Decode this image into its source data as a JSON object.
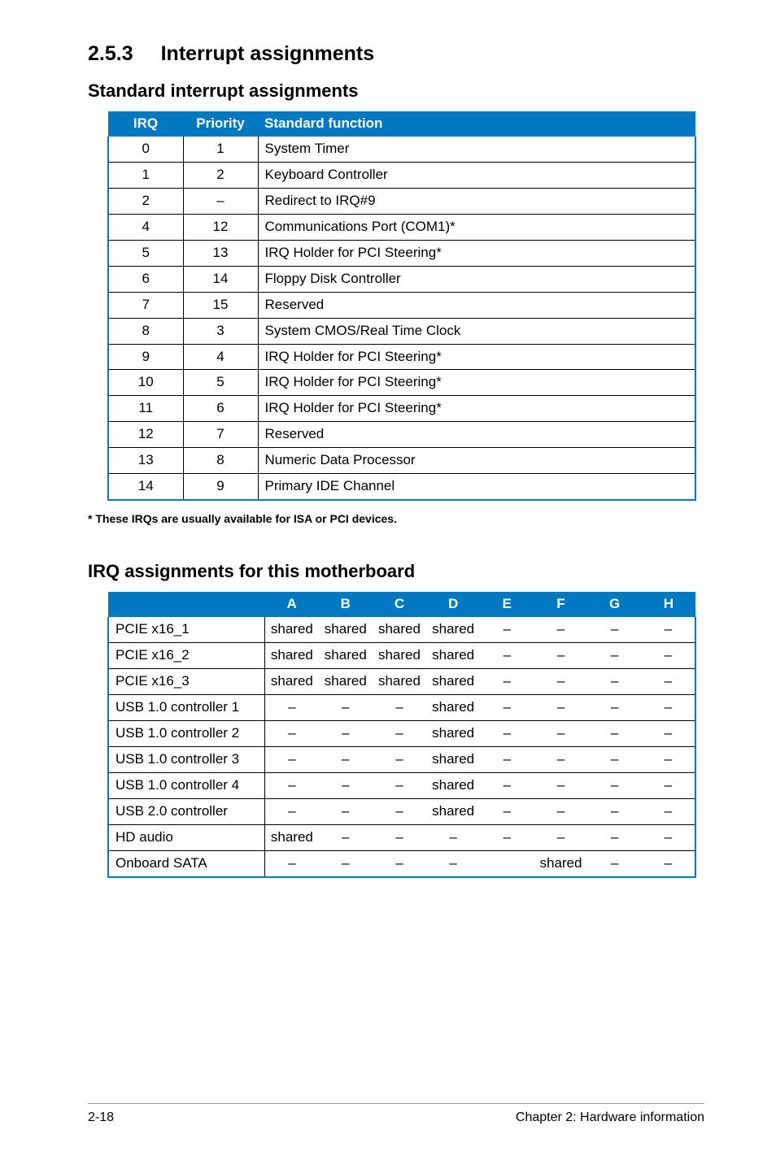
{
  "heading": {
    "number": "2.5.3",
    "title": "Interrupt assignments"
  },
  "sub1": "Standard interrupt assignments",
  "t1": {
    "headers": {
      "irq": "IRQ",
      "priority": "Priority",
      "func": "Standard function"
    },
    "rows": [
      {
        "irq": "0",
        "priority": "1",
        "func": "System Timer"
      },
      {
        "irq": "1",
        "priority": "2",
        "func": "Keyboard Controller"
      },
      {
        "irq": "2",
        "priority": "–",
        "func": "Redirect to IRQ#9"
      },
      {
        "irq": "4",
        "priority": "12",
        "func": "Communications Port (COM1)*"
      },
      {
        "irq": "5",
        "priority": "13",
        "func": "IRQ Holder for PCI Steering*"
      },
      {
        "irq": "6",
        "priority": "14",
        "func": "Floppy Disk Controller"
      },
      {
        "irq": "7",
        "priority": "15",
        "func": "Reserved"
      },
      {
        "irq": "8",
        "priority": "3",
        "func": "System CMOS/Real Time Clock"
      },
      {
        "irq": "9",
        "priority": "4",
        "func": "IRQ Holder for PCI Steering*"
      },
      {
        "irq": "10",
        "priority": "5",
        "func": "IRQ Holder for PCI Steering*"
      },
      {
        "irq": "11",
        "priority": "6",
        "func": "IRQ Holder for PCI Steering*"
      },
      {
        "irq": "12",
        "priority": "7",
        "func": "Reserved"
      },
      {
        "irq": "13",
        "priority": "8",
        "func": "Numeric Data Processor"
      },
      {
        "irq": "14",
        "priority": "9",
        "func": "Primary IDE Channel"
      }
    ]
  },
  "footnote": "* These IRQs are usually available for ISA or PCI devices.",
  "sub2": "IRQ assignments for this motherboard",
  "t2": {
    "headers": {
      "blank": "",
      "a": "A",
      "b": "B",
      "c": "C",
      "d": "D",
      "e": "E",
      "f": "F",
      "g": "G",
      "h": "H"
    },
    "rows": [
      {
        "dev": "PCIE x16_1",
        "a": "shared",
        "b": "shared",
        "c": "shared",
        "d": "shared",
        "e": "–",
        "f": "–",
        "g": "–",
        "h": "–"
      },
      {
        "dev": "PCIE x16_2",
        "a": "shared",
        "b": "shared",
        "c": "shared",
        "d": "shared",
        "e": "–",
        "f": "–",
        "g": "–",
        "h": "–"
      },
      {
        "dev": "PCIE x16_3",
        "a": "shared",
        "b": "shared",
        "c": "shared",
        "d": "shared",
        "e": "–",
        "f": "–",
        "g": "–",
        "h": "–"
      },
      {
        "dev": "USB 1.0 controller 1",
        "a": "–",
        "b": "–",
        "c": "–",
        "d": "shared",
        "e": "–",
        "f": "–",
        "g": "–",
        "h": "–"
      },
      {
        "dev": "USB 1.0 controller 2",
        "a": "–",
        "b": "–",
        "c": "–",
        "d": "shared",
        "e": "–",
        "f": "–",
        "g": "–",
        "h": "–"
      },
      {
        "dev": "USB 1.0 controller 3",
        "a": "–",
        "b": "–",
        "c": "–",
        "d": "shared",
        "e": "–",
        "f": "–",
        "g": "–",
        "h": "–"
      },
      {
        "dev": "USB 1.0 controller 4",
        "a": "–",
        "b": "–",
        "c": "–",
        "d": "shared",
        "e": "–",
        "f": "–",
        "g": "–",
        "h": "–"
      },
      {
        "dev": "USB 2.0 controller",
        "a": "–",
        "b": "–",
        "c": "–",
        "d": "shared",
        "e": "–",
        "f": "–",
        "g": "–",
        "h": "–"
      },
      {
        "dev": "HD audio",
        "a": "shared",
        "b": "–",
        "c": "–",
        "d": "–",
        "e": "–",
        "f": "–",
        "g": "–",
        "h": "–"
      },
      {
        "dev": "Onboard SATA",
        "a": "–",
        "b": "–",
        "c": "–",
        "d": "–",
        "e": "",
        "f": "shared",
        "g": "–",
        "h": "–"
      }
    ]
  },
  "footer": {
    "left": "2-18",
    "right": "Chapter 2: Hardware information"
  }
}
